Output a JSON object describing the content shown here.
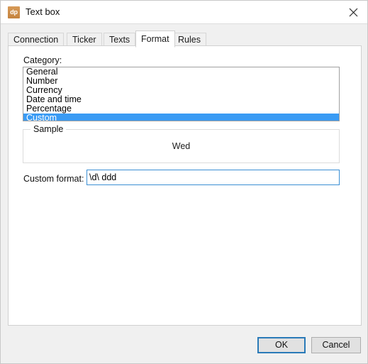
{
  "window": {
    "title": "Text box",
    "icon": "dp",
    "icon_name": "app-icon-dp",
    "close_icon": "close-icon",
    "accent_blue": "#3a9bf4",
    "focus_blue": "#2a7ab8",
    "icon_color": "#c4833f"
  },
  "tabs": [
    {
      "label": "Connection",
      "active": false
    },
    {
      "label": "Ticker",
      "active": false
    },
    {
      "label": "Texts",
      "active": false
    },
    {
      "label": "Format",
      "active": true
    },
    {
      "label": "Rules",
      "active": false
    }
  ],
  "format_tab": {
    "category": {
      "label": "Category:",
      "items": [
        {
          "label": "General",
          "selected": false
        },
        {
          "label": "Number",
          "selected": false
        },
        {
          "label": "Currency",
          "selected": false
        },
        {
          "label": "Date and time",
          "selected": false
        },
        {
          "label": "Percentage",
          "selected": false
        },
        {
          "label": "Custom",
          "selected": true
        }
      ],
      "selected_value": "Custom"
    },
    "sample": {
      "legend": "Sample",
      "value": "Wed"
    },
    "custom_format": {
      "label": "Custom format:",
      "value": "\\d\\ ddd",
      "placeholder": ""
    }
  },
  "footer": {
    "ok_label": "OK",
    "cancel_label": "Cancel"
  }
}
